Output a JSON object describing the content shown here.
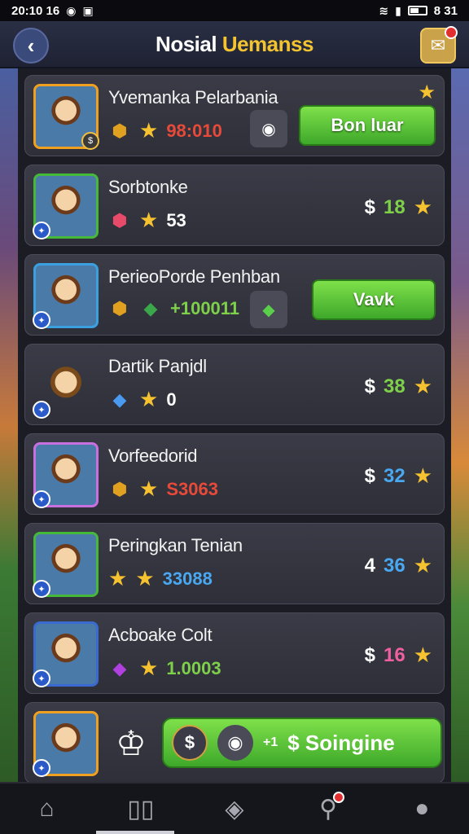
{
  "status_bar": {
    "time": "20:10 16",
    "right_text": "8 31"
  },
  "header": {
    "title_part1": "Nosial",
    "title_part2": "Uemanss"
  },
  "cards": [
    {
      "name": "Yvemanka Pelarbania",
      "value": "98:010",
      "button": "Bon luar"
    },
    {
      "name": "Sorbtonke",
      "value": "53",
      "right_value": "18"
    },
    {
      "name": "PerieoPorde Penhban",
      "value": "+100011",
      "button": "Vavk"
    },
    {
      "name": "Dartik Panjdl",
      "value": "0",
      "right_value": "38"
    },
    {
      "name": "Vorfeedorid",
      "value": "S3063",
      "right_value": "32"
    },
    {
      "name": "Peringkan Tenian",
      "value": "33088",
      "right_prefix": "4",
      "right_value": "36"
    },
    {
      "name": "Acboake Colt",
      "value": "1.0003",
      "right_value": "16"
    }
  ],
  "promo": {
    "label": "$ Soingine",
    "prefix": "+1"
  },
  "nav": {
    "items": [
      "home-icon",
      "cards-icon",
      "box-icon",
      "search-icon",
      "profile-icon"
    ]
  }
}
